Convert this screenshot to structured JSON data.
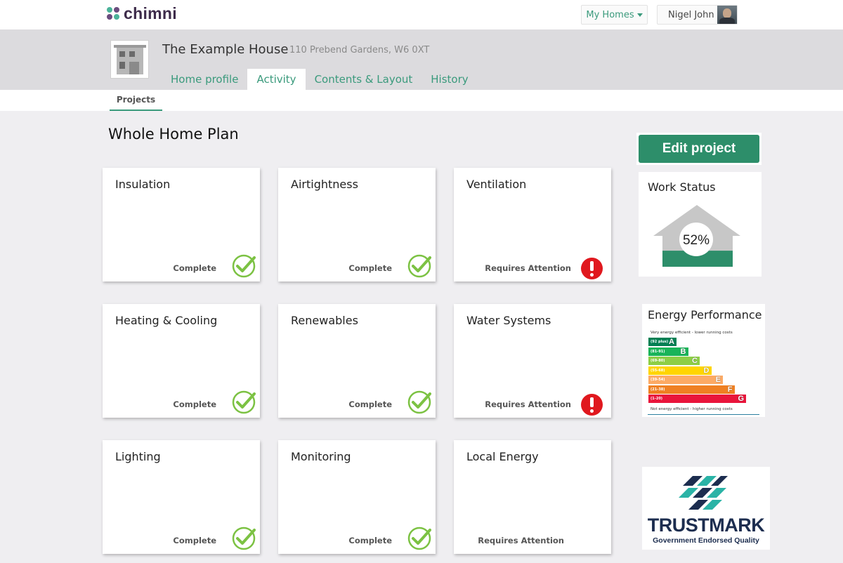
{
  "app": {
    "logo_text": "chimni",
    "my_homes_label": "My Homes",
    "user_name": "Nigel John"
  },
  "property": {
    "title": "The Example House",
    "address": "110 Prebend Gardens, W6 0XT"
  },
  "tabs": [
    {
      "label": "Home profile",
      "active": false
    },
    {
      "label": "Activity",
      "active": true
    },
    {
      "label": "Contents & Layout",
      "active": false
    },
    {
      "label": "History",
      "active": false
    }
  ],
  "subtabs": [
    {
      "label": "Projects",
      "active": true
    }
  ],
  "page_title": "Whole Home Plan",
  "cards": [
    {
      "title": "Insulation",
      "status": "Complete",
      "state": "complete"
    },
    {
      "title": "Airtightness",
      "status": "Complete",
      "state": "complete"
    },
    {
      "title": "Ventilation",
      "status": "Requires Attention",
      "state": "attention"
    },
    {
      "title": "Heating & Cooling",
      "status": "Complete",
      "state": "complete"
    },
    {
      "title": "Renewables",
      "status": "Complete",
      "state": "complete"
    },
    {
      "title": "Water Systems",
      "status": "Requires Attention",
      "state": "attention"
    },
    {
      "title": "Lighting",
      "status": "Complete",
      "state": "complete"
    },
    {
      "title": "Monitoring",
      "status": "Complete",
      "state": "complete"
    },
    {
      "title": "Local Energy",
      "status": "Requires Attention",
      "state": "none"
    }
  ],
  "edit_button_label": "Edit project",
  "work_status": {
    "title": "Work Status",
    "percent_label": "52%",
    "percent_value": 52
  },
  "energy_performance": {
    "title": "Energy Performance",
    "top_note": "Very energy efficient - lower running costs",
    "bottom_note": "Not energy efficient - higher running costs",
    "bands": [
      {
        "range": "(92 plus)",
        "letter": "A",
        "color": "#008054"
      },
      {
        "range": "(81-91)",
        "letter": "B",
        "color": "#19b459"
      },
      {
        "range": "(69-80)",
        "letter": "C",
        "color": "#8dce46"
      },
      {
        "range": "(55-68)",
        "letter": "D",
        "color": "#ffd500"
      },
      {
        "range": "(39-54)",
        "letter": "E",
        "color": "#fcaa65"
      },
      {
        "range": "(21-38)",
        "letter": "F",
        "color": "#ef8023"
      },
      {
        "range": "(1-20)",
        "letter": "G",
        "color": "#e9153b"
      }
    ]
  },
  "trustmark": {
    "word": "TRUSTMARK",
    "subtitle": "Government Endorsed Quality"
  },
  "colors": {
    "accent": "#3a9a7c",
    "button": "#2d8e6a",
    "alert": "#e0181e",
    "check": "#7cc243"
  },
  "icons": {
    "complete": "check-circle-icon",
    "attention": "exclamation-circle-icon"
  }
}
